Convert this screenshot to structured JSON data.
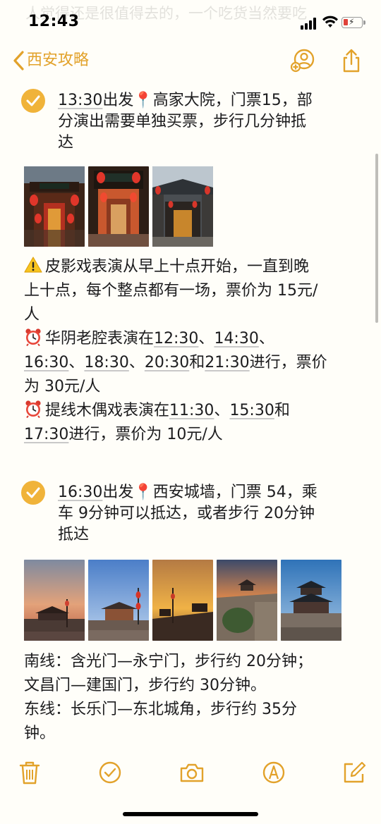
{
  "status": {
    "time": "12:43"
  },
  "ghost_text": "人觉得还是很值得去的，一个吃货当然要吃",
  "nav": {
    "back_label": "西安攻略"
  },
  "content": {
    "item1": {
      "time": "13:30",
      "line1_rest": "出发📍高家大院，门票15，部",
      "line2": "分演出需要单独买票，步行几分钟抵",
      "line3": "达"
    },
    "notes1": {
      "l1": "皮影戏表演从早上十点开始，一直到晚",
      "l2": "上十点，每个整点都有一场，票价为 15元/",
      "l3": "人",
      "l4_a": "华阴老腔表演在",
      "l4_t1": "12:30",
      "l4_b": "、",
      "l4_t2": "14:30",
      "l4_c": "、",
      "l5_t1": "16:30",
      "l5_a": "、",
      "l5_t2": "18:30",
      "l5_b": "、",
      "l5_t3": "20:30",
      "l5_c": "和",
      "l5_t4": "21:30",
      "l5_d": "进行，票价",
      "l6": "为 30元/人",
      "l7_a": "提线木偶戏表演在",
      "l7_t1": "11:30",
      "l7_b": "、",
      "l7_t2": "15:30",
      "l7_c": "和",
      "l8_t1": "17:30",
      "l8_a": "进行，票价为 10元/人"
    },
    "item2": {
      "time": "16:30",
      "line1_rest": "出发📍西安城墙，门票 54，乘",
      "line2": "车 9分钟可以抵达，或者步行 20分钟",
      "line3": "抵达"
    },
    "notes2": {
      "l1": "南线：含光门—永宁门，步行约 20分钟；",
      "l2": "文昌门—建国门，步行约 30分钟。",
      "l3": "东线：长乐门—东北城角，步行约 35分",
      "l4": "钟。"
    }
  },
  "icons": {
    "warning": "warning-icon",
    "alarm": "alarm-clock-icon",
    "pin": "round-pushpin-icon"
  },
  "colors": {
    "accent": "#e2a22b",
    "check": "#f0b33a",
    "background": "#fffef9"
  }
}
